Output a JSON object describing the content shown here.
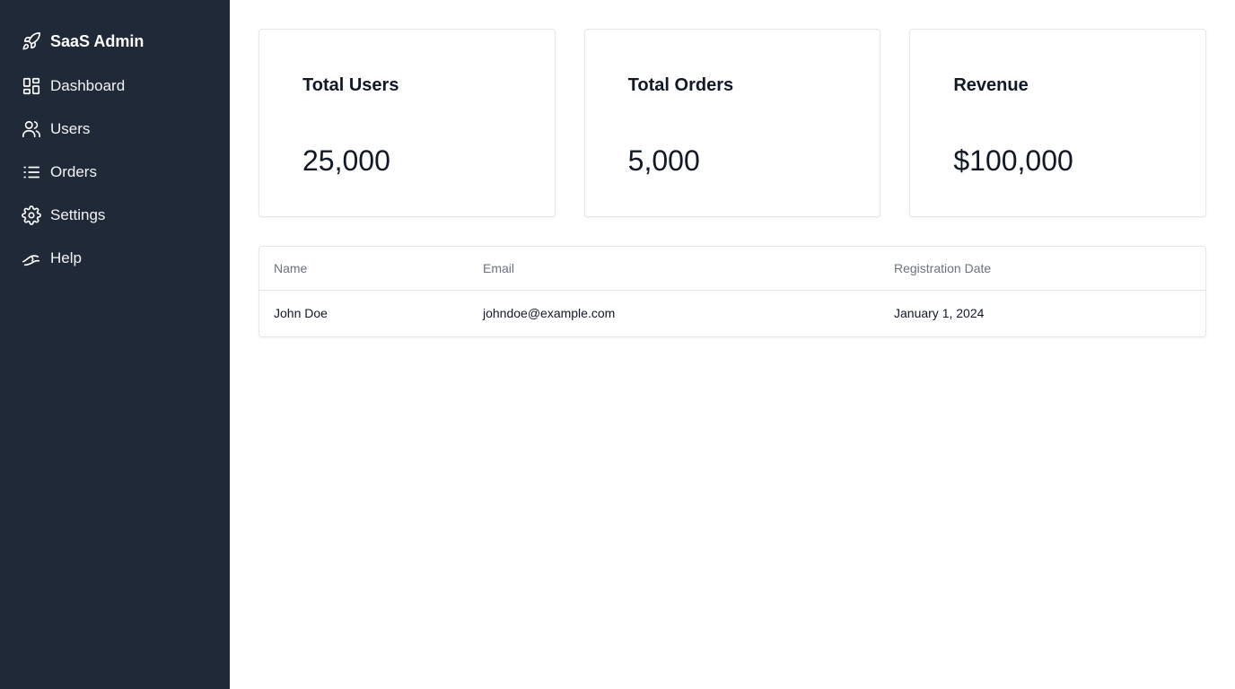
{
  "sidebar": {
    "brand": {
      "name": "SaaS Admin",
      "icon": "rocket-icon"
    },
    "items": [
      {
        "label": "Dashboard",
        "icon": "dashboard-icon"
      },
      {
        "label": "Users",
        "icon": "users-icon"
      },
      {
        "label": "Orders",
        "icon": "list-icon"
      },
      {
        "label": "Settings",
        "icon": "gear-icon"
      },
      {
        "label": "Help",
        "icon": "help-icon"
      }
    ]
  },
  "cards": [
    {
      "title": "Total Users",
      "value": "25,000"
    },
    {
      "title": "Total Orders",
      "value": "5,000"
    },
    {
      "title": "Revenue",
      "value": "$100,000"
    }
  ],
  "table": {
    "headers": [
      "Name",
      "Email",
      "Registration Date"
    ],
    "rows": [
      [
        "John Doe",
        "johndoe@example.com",
        "January 1, 2024"
      ]
    ]
  },
  "colors": {
    "sidebar_bg": "#1f2937",
    "text_primary": "#111827",
    "text_muted": "#6b7280",
    "border": "#e5e7eb"
  }
}
